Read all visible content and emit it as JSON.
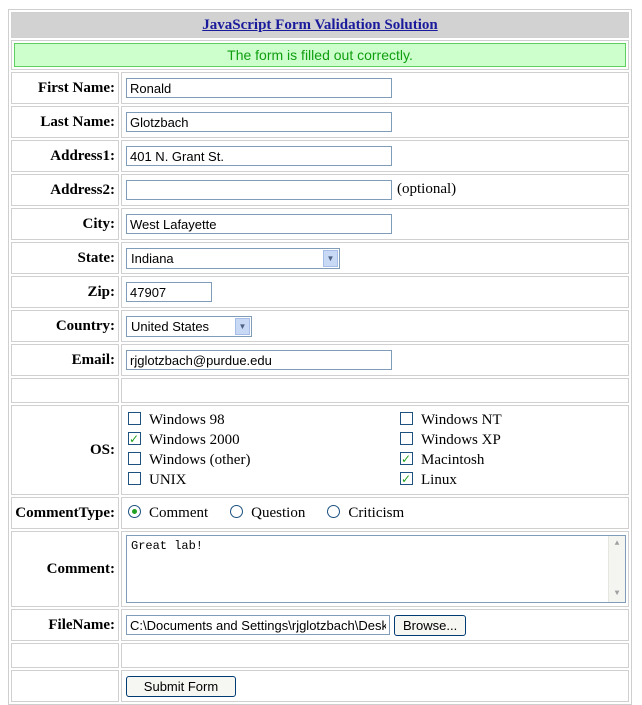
{
  "header": {
    "title": "JavaScript Form Validation Solution"
  },
  "message": "The form is filled out correctly.",
  "fields": {
    "first_name": {
      "label": "First Name:",
      "value": "Ronald"
    },
    "last_name": {
      "label": "Last Name:",
      "value": "Glotzbach"
    },
    "address1": {
      "label": "Address1:",
      "value": "401 N. Grant St."
    },
    "address2": {
      "label": "Address2:",
      "value": "",
      "note": "(optional)"
    },
    "city": {
      "label": "City:",
      "value": "West Lafayette"
    },
    "state": {
      "label": "State:",
      "value": "Indiana"
    },
    "zip": {
      "label": "Zip:",
      "value": "47907"
    },
    "country": {
      "label": "Country:",
      "value": "United States"
    },
    "email": {
      "label": "Email:",
      "value": "rjglotzbach@purdue.edu"
    }
  },
  "os": {
    "label": "OS:",
    "options": [
      {
        "label": "Windows 98",
        "checked": false
      },
      {
        "label": "Windows NT",
        "checked": false
      },
      {
        "label": "Windows 2000",
        "checked": true
      },
      {
        "label": "Windows XP",
        "checked": false
      },
      {
        "label": "Windows (other)",
        "checked": false
      },
      {
        "label": "Macintosh",
        "checked": true
      },
      {
        "label": "UNIX",
        "checked": false
      },
      {
        "label": "Linux",
        "checked": true
      }
    ]
  },
  "comment_type": {
    "label": "CommentType:",
    "options": [
      {
        "label": "Comment",
        "checked": true
      },
      {
        "label": "Question",
        "checked": false
      },
      {
        "label": "Criticism",
        "checked": false
      }
    ]
  },
  "comment": {
    "label": "Comment:",
    "value": "Great lab!"
  },
  "file": {
    "label": "FileName:",
    "value": "C:\\Documents and Settings\\rjglotzbach\\Desktop",
    "browse_label": "Browse..."
  },
  "submit_label": "Submit Form",
  "colors": {
    "message_bg": "#ccffcc",
    "message_text": "#109e10",
    "header_bg": "#d2d2d2",
    "check_green": "#21a121"
  }
}
